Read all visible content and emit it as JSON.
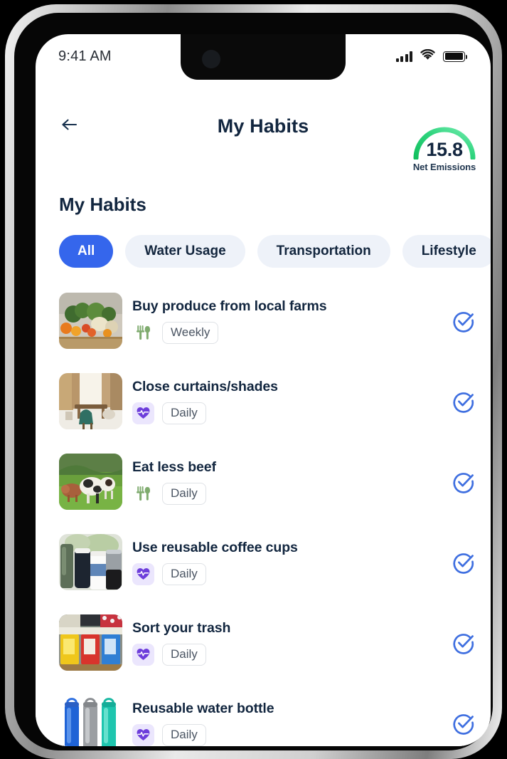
{
  "status_bar": {
    "time": "9:41 AM",
    "signal_icon": "cellular-signal-icon",
    "wifi_icon": "wifi-icon",
    "battery_icon": "battery-full-icon"
  },
  "nav": {
    "back_icon": "back-arrow-icon",
    "title": "My Habits",
    "gauge": {
      "value": "15.8",
      "label": "Net Emissions",
      "arc_color_start": "#17c964",
      "arc_color_end": "#5ce8a0"
    }
  },
  "page": {
    "title": "My Habits"
  },
  "filters": {
    "items": [
      {
        "label": "All",
        "active": true
      },
      {
        "label": "Water Usage",
        "active": false
      },
      {
        "label": "Transportation",
        "active": false
      },
      {
        "label": "Lifestyle",
        "active": false
      }
    ],
    "active_color": "#3566ec",
    "inactive_color": "#eef2f9"
  },
  "habits": [
    {
      "title": "Buy produce from local farms",
      "frequency": "Weekly",
      "category_icon": "fork-knife-icon",
      "category_style": "food",
      "thumb": "produce-crate-photo",
      "check_icon": "check-circle-icon",
      "checked": true
    },
    {
      "title": "Close curtains/shades",
      "frequency": "Daily",
      "category_icon": "heartbeat-icon",
      "category_style": "health",
      "thumb": "living-room-photo",
      "check_icon": "check-circle-icon",
      "checked": true
    },
    {
      "title": "Eat less beef",
      "frequency": "Daily",
      "category_icon": "fork-knife-icon",
      "category_style": "food",
      "thumb": "cows-pasture-photo",
      "check_icon": "check-circle-icon",
      "checked": true
    },
    {
      "title": "Use reusable coffee cups",
      "frequency": "Daily",
      "category_icon": "heartbeat-icon",
      "category_style": "health",
      "thumb": "travel-mugs-photo",
      "check_icon": "check-circle-icon",
      "checked": true
    },
    {
      "title": "Sort your trash",
      "frequency": "Daily",
      "category_icon": "heartbeat-icon",
      "category_style": "health",
      "thumb": "recycling-bins-photo",
      "check_icon": "check-circle-icon",
      "checked": true
    },
    {
      "title": "Reusable water bottle",
      "frequency": "Daily",
      "category_icon": "heartbeat-icon",
      "category_style": "health",
      "thumb": "water-bottles-photo",
      "check_icon": "check-circle-icon",
      "checked": true
    }
  ],
  "colors": {
    "text_dark": "#12263f",
    "accent_blue": "#3566ec",
    "check_blue": "#3f6fe0",
    "food_green": "#7fab6e",
    "health_purple": "#6d3ddb",
    "gauge_green": "#17c964"
  }
}
